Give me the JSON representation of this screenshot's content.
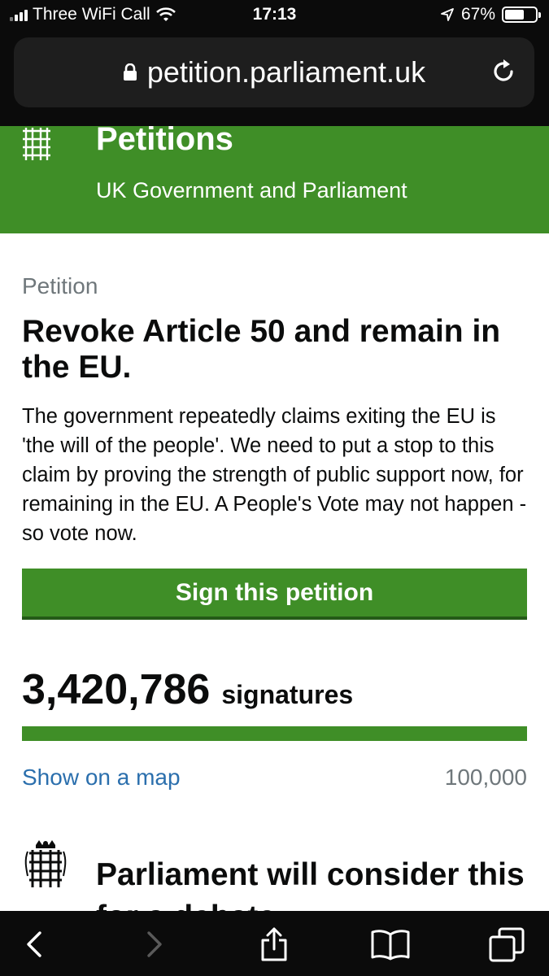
{
  "status_bar": {
    "carrier": "Three WiFi Call",
    "time": "17:13",
    "battery": "67%",
    "battery_level": 0.67
  },
  "browser": {
    "url": "petition.parliament.uk"
  },
  "header": {
    "title": "Petitions",
    "subtitle": "UK Government and Parliament"
  },
  "petition": {
    "label": "Petition",
    "title": "Revoke Article 50 and remain in the EU.",
    "description": "The government repeatedly claims exiting the EU is 'the will of the people'. We need to put a stop to this claim by proving the strength of public support now, for remaining in the EU. A People's Vote may not happen - so vote now.",
    "sign_button": "Sign this petition",
    "signature_count": "3,420,786",
    "signature_label": "signatures",
    "progress_fraction": 1.0,
    "map_link": "Show on a map",
    "target": "100,000"
  },
  "next_section": {
    "title": "Parliament will consider this for a debate"
  },
  "colors": {
    "brand_green": "#3f8e27",
    "link_blue": "#2b6fad",
    "grey_text": "#6f777b"
  },
  "toolbar_icons": [
    "back-icon",
    "forward-icon",
    "share-icon",
    "bookmarks-icon",
    "tabs-icon"
  ]
}
